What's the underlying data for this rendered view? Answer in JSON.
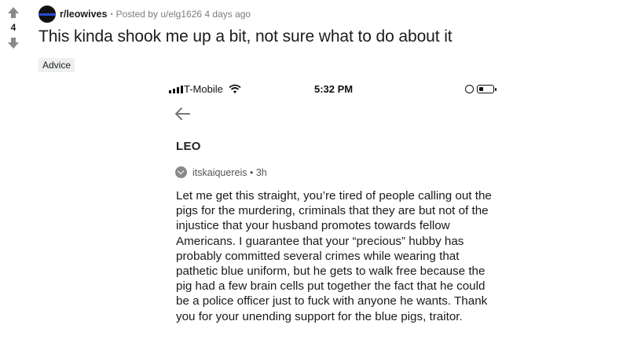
{
  "post": {
    "score": "4",
    "subreddit": "r/leowives",
    "posted_by": "Posted by",
    "author": "u/elg1626",
    "age": "4 days ago",
    "title": "This kinda shook me up a bit, not sure what to do about it",
    "flair": "Advice"
  },
  "screenshot": {
    "carrier": "T-Mobile",
    "time": "5:32 PM",
    "group": "LEO",
    "comment_author": "itskaiquereis",
    "comment_age": "3h",
    "comment_text": "Let me get this straight, you’re tired of people calling out the pigs for the murdering, criminals that they are but not of the injustice that your husband promotes towards fellow Americans. I guarantee that your “precious” hubby has probably committed several crimes while wearing that pathetic blue uniform, but he gets to walk free because the pig had a few brain cells put together the fact that he could be a police officer just to fuck with anyone he wants. Thank you for your unending support for the blue pigs, traitor."
  },
  "icons": {
    "upvote": "upvote-arrow-icon",
    "downvote": "downvote-arrow-icon",
    "subreddit": "subreddit-icon",
    "back": "back-arrow-icon",
    "signal": "signal-bars-icon",
    "wifi": "wifi-icon",
    "battery": "battery-icon"
  }
}
